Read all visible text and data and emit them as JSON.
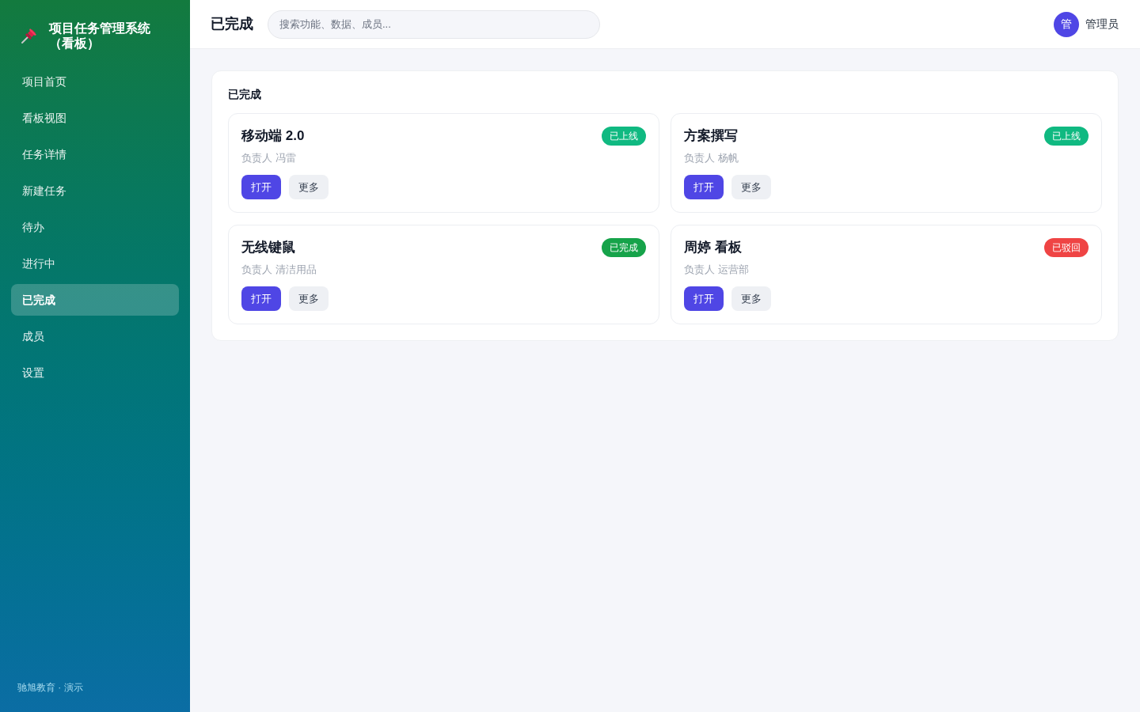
{
  "sidebar": {
    "logo": {
      "title": "项目任务管理系统（看板）"
    },
    "items": [
      {
        "label": "项目首页",
        "selected": false
      },
      {
        "label": "看板视图",
        "selected": false
      },
      {
        "label": "任务详情",
        "selected": false
      },
      {
        "label": "新建任务",
        "selected": false
      },
      {
        "label": "待办",
        "selected": false
      },
      {
        "label": "进行中",
        "selected": false
      },
      {
        "label": "已完成",
        "selected": true
      },
      {
        "label": "成员",
        "selected": false
      },
      {
        "label": "设置",
        "selected": false
      }
    ],
    "footer": "驰旭教育 · 演示"
  },
  "header": {
    "title": "已完成",
    "search": {
      "placeholder": "搜索功能、数据、成员..."
    },
    "user": {
      "avatar": "管",
      "name": "管理员"
    }
  },
  "panel": {
    "title": "已完成",
    "cards": [
      {
        "title": "移动端 2.0",
        "status": {
          "label": "已上线",
          "color": "#10b981"
        },
        "owner": "负责人 冯雷",
        "buttons": [
          {
            "label": "打开",
            "kind": "primary"
          },
          {
            "label": "更多",
            "kind": "secondary"
          }
        ]
      },
      {
        "title": "方案撰写",
        "status": {
          "label": "已上线",
          "color": "#10b981"
        },
        "owner": "负责人 杨帆",
        "buttons": [
          {
            "label": "打开",
            "kind": "primary"
          },
          {
            "label": "更多",
            "kind": "secondary"
          }
        ]
      },
      {
        "title": "无线键鼠",
        "status": {
          "label": "已完成",
          "color": "#16a34a"
        },
        "owner": "负责人 清洁用品",
        "buttons": [
          {
            "label": "打开",
            "kind": "primary"
          },
          {
            "label": "更多",
            "kind": "secondary"
          }
        ]
      },
      {
        "title": "周婷 看板",
        "status": {
          "label": "已驳回",
          "color": "#ef4444"
        },
        "owner": "负责人 运营部",
        "buttons": [
          {
            "label": "打开",
            "kind": "primary"
          },
          {
            "label": "更多",
            "kind": "secondary"
          }
        ]
      }
    ]
  }
}
